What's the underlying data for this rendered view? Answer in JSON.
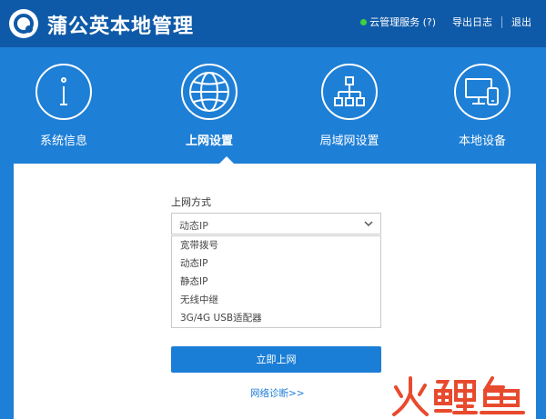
{
  "header": {
    "title": "蒲公英本地管理",
    "cloud_service": "云管理服务 (?)",
    "export_log": "导出日志",
    "logout": "退出",
    "status_color": "#3fd13f"
  },
  "nav": {
    "items": [
      {
        "label": "系统信息",
        "icon": "info-icon"
      },
      {
        "label": "上网设置",
        "icon": "globe-icon",
        "active": true
      },
      {
        "label": "局域网设置",
        "icon": "network-icon"
      },
      {
        "label": "本地设备",
        "icon": "monitor-device-icon"
      }
    ]
  },
  "form": {
    "label": "上网方式",
    "selected": "动态IP",
    "options": [
      "宽带拨号",
      "动态IP",
      "静态IP",
      "无线中继",
      "3G/4G USB适配器"
    ],
    "submit": "立即上网",
    "diagnose": "网络诊断>>"
  },
  "watermark": {
    "text": "火鲤鱼"
  },
  "colors": {
    "header_bg": "#0f5aa8",
    "nav_bg": "#1e7fd6",
    "primary": "#1b7ed6",
    "watermark": "#e84a2e"
  }
}
